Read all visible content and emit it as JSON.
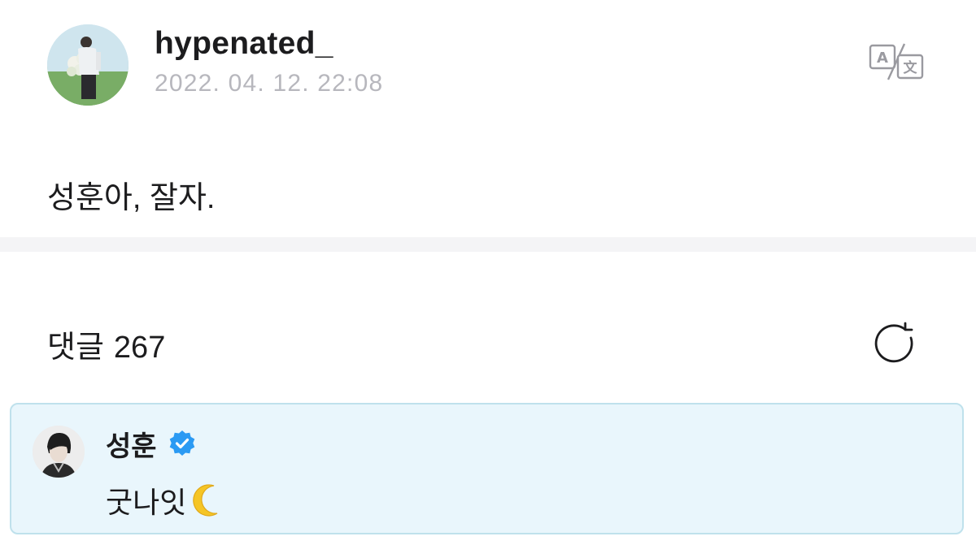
{
  "post": {
    "author": "hypenated_",
    "timestamp": "2022. 04. 12. 22:08",
    "body": "성훈아, 잘자.",
    "avatar_icon": "profile-photo-flower-field",
    "translate_icon": "translate-icon"
  },
  "comments": {
    "label": "댓글",
    "count": "267",
    "refresh_icon": "refresh-icon",
    "highlighted": {
      "author": "성훈",
      "verified": true,
      "text": "굿나잇",
      "emoji_icon": "crescent-moon-icon",
      "accent_border": "#bfe1ec",
      "background": "#e9f6fc"
    }
  },
  "colors": {
    "verified_badge": "#2b9af3",
    "timestamp": "#b7b7bd",
    "divider": "#f4f4f6"
  }
}
